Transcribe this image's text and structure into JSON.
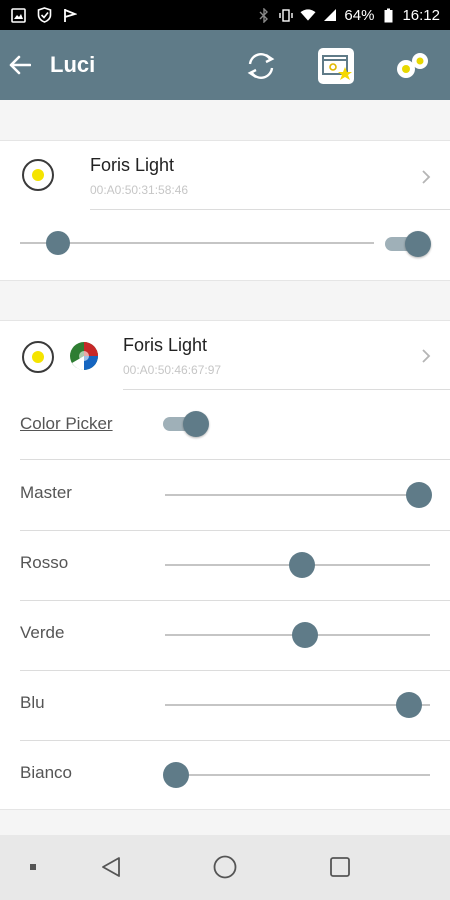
{
  "status_bar": {
    "battery": "64%",
    "time": "16:12",
    "icons": [
      "image-icon",
      "shield-icon",
      "flag-icon",
      "bluetooth-icon",
      "vibrate-icon",
      "wifi-icon",
      "signal-icon",
      "battery-icon"
    ]
  },
  "app_bar": {
    "title": "Luci",
    "background": "#5f7b88",
    "actions": [
      "refresh-icon",
      "scene-favorite-icon",
      "bubbles-icon"
    ]
  },
  "devices": [
    {
      "name": "Foris Light",
      "mac": "00:A0:50:31:58:46",
      "selected_color": "#f5e400",
      "slider": 0.08,
      "power_on": true
    },
    {
      "name": "Foris Light",
      "mac": "00:A0:50:46:67:97",
      "selected_color": "#f5e400",
      "color_picker": {
        "label": "Color Picker",
        "on": true
      },
      "channels": [
        {
          "label": "Master",
          "value": 1.0
        },
        {
          "label": "Rosso",
          "value": 0.52
        },
        {
          "label": "Verde",
          "value": 0.53
        },
        {
          "label": "Blu",
          "value": 0.96
        },
        {
          "label": "Bianco",
          "value": 0.0
        }
      ]
    }
  ],
  "nav_bar": {
    "buttons": [
      "square-dot-icon",
      "back-triangle-icon",
      "home-circle-icon",
      "recents-square-icon"
    ]
  },
  "colors": {
    "accent": "#5f7b88",
    "bulb": "#f5e400"
  }
}
